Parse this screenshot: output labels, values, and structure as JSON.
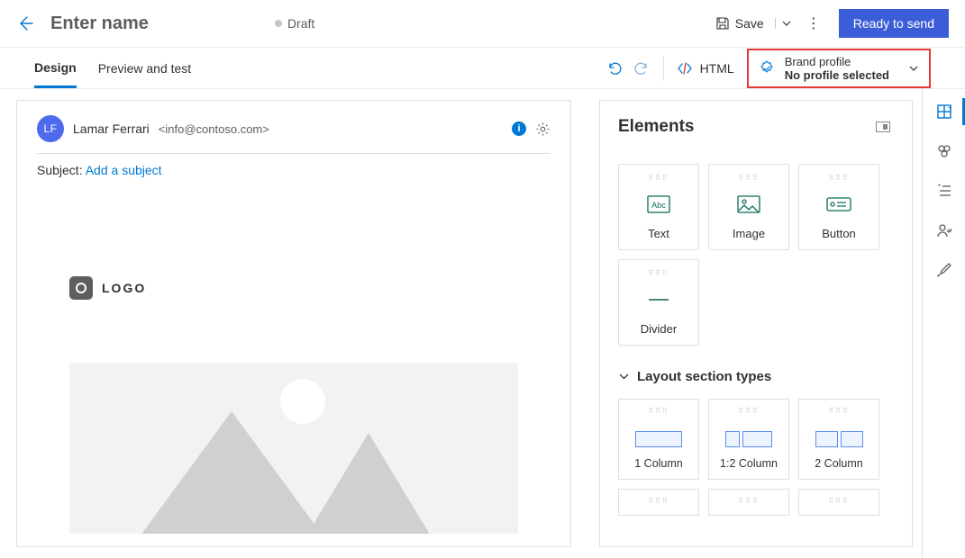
{
  "header": {
    "title_placeholder": "Enter name",
    "status": "Draft",
    "save_label": "Save",
    "ready_label": "Ready to send"
  },
  "tabs": {
    "design": "Design",
    "preview": "Preview and test",
    "html_toggle": "HTML",
    "brand": {
      "label": "Brand profile",
      "value": "No profile selected"
    }
  },
  "canvas": {
    "sender": {
      "initials": "LF",
      "name": "Lamar Ferrari",
      "email": "<info@contoso.com>"
    },
    "subject_label": "Subject:",
    "subject_placeholder": "Add a subject",
    "logo_text": "LOGO"
  },
  "elements": {
    "title": "Elements",
    "items": [
      {
        "label": "Text"
      },
      {
        "label": "Image"
      },
      {
        "label": "Button"
      },
      {
        "label": "Divider"
      }
    ],
    "layout_title": "Layout section types",
    "layouts": [
      {
        "label": "1 Column"
      },
      {
        "label": "1:2 Column"
      },
      {
        "label": "2 Column"
      }
    ]
  }
}
